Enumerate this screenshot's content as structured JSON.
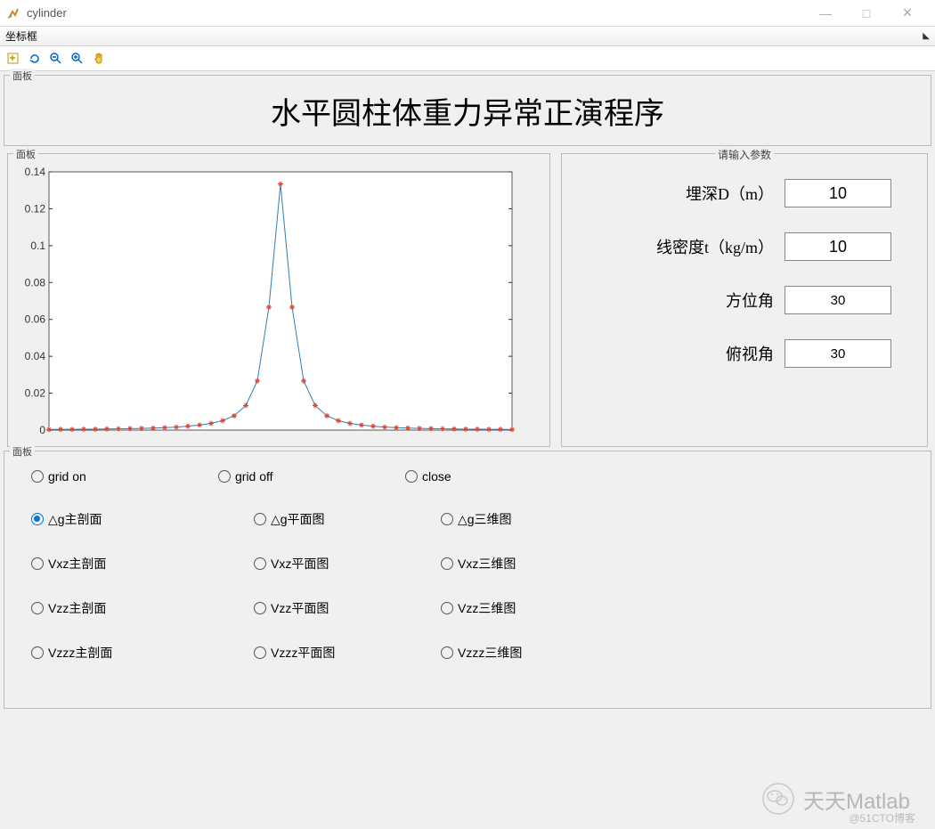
{
  "window": {
    "title": "cylinder"
  },
  "menubar": {
    "item0": "坐标框"
  },
  "panel_labels": {
    "generic": "面板",
    "input": "请输入参数"
  },
  "main_title": "水平圆柱体重力异常正演程序",
  "params": {
    "depth": {
      "label": "埋深D（m）",
      "value": "10"
    },
    "density": {
      "label": "线密度t（kg/m）",
      "value": "10"
    },
    "azimuth": {
      "label": "方位角",
      "value": "30"
    },
    "elevation": {
      "label": "俯视角",
      "value": "30"
    }
  },
  "radios": {
    "row0": {
      "c0": "grid on",
      "c1": "grid off",
      "c2": "close"
    },
    "row1": {
      "c0": "△g主剖面",
      "c1": "△g平面图",
      "c2": "△g三维图"
    },
    "row2": {
      "c0": "Vxz主剖面",
      "c1": "Vxz平面图",
      "c2": "Vxz三维图"
    },
    "row3": {
      "c0": "Vzz主剖面",
      "c1": "Vzz平面图",
      "c2": "Vzz三维图"
    },
    "row4": {
      "c0": "Vzzz主剖面",
      "c1": "Vzzz平面图",
      "c2": "Vzzz三维图"
    }
  },
  "chart_data": {
    "type": "line",
    "title": "",
    "xlabel": "",
    "ylabel": "",
    "xlim": [
      -200,
      200
    ],
    "ylim": [
      0,
      0.14
    ],
    "yticks": [
      0,
      0.02,
      0.04,
      0.06,
      0.08,
      0.1,
      0.12,
      0.14
    ],
    "x": [
      -200,
      -190,
      -180,
      -170,
      -160,
      -150,
      -140,
      -130,
      -120,
      -110,
      -100,
      -90,
      -80,
      -70,
      -60,
      -50,
      -40,
      -30,
      -20,
      -10,
      0,
      10,
      20,
      30,
      40,
      50,
      60,
      70,
      80,
      90,
      100,
      110,
      120,
      130,
      140,
      150,
      160,
      170,
      180,
      190,
      200
    ],
    "values": [
      0.0003,
      0.0004,
      0.0004,
      0.0005,
      0.0005,
      0.0006,
      0.0007,
      0.0008,
      0.0009,
      0.0011,
      0.0013,
      0.0016,
      0.0021,
      0.0027,
      0.0036,
      0.0051,
      0.0078,
      0.0133,
      0.0267,
      0.0667,
      0.1334,
      0.0667,
      0.0267,
      0.0133,
      0.0078,
      0.0051,
      0.0036,
      0.0027,
      0.0021,
      0.0016,
      0.0013,
      0.0011,
      0.0009,
      0.0008,
      0.0007,
      0.0006,
      0.0005,
      0.0005,
      0.0004,
      0.0004,
      0.0003
    ]
  },
  "watermark": {
    "main": "天天Matlab",
    "sub": "@51CTO博客"
  }
}
